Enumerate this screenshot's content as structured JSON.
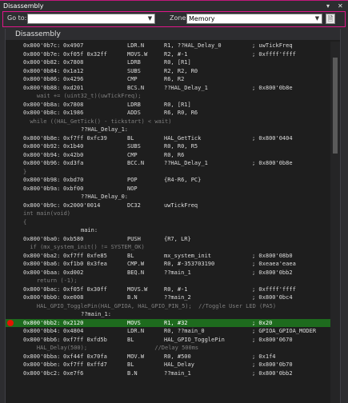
{
  "window": {
    "title": "Disassembly",
    "controls": [
      "▾",
      "✕"
    ]
  },
  "toolbar": {
    "goto_label": "Go to:",
    "goto_value": "",
    "zone_label": "Zone:",
    "zone_value": "Memory"
  },
  "panel": {
    "header": "Disassembly"
  },
  "rows": [
    {
      "kind": "asm",
      "addr": "0x800'0b7c:",
      "bytes": "0x4907",
      "mn": "LDR.N",
      "ops": "R1, ??HAL_Delay_0",
      "cmt": "; uwTickFreq"
    },
    {
      "kind": "asm",
      "addr": "0x800'0b7e:",
      "bytes": "0xf05f 0x32ff",
      "mn": "MOVS.W",
      "ops": "R2, #-1",
      "cmt": "; 0xffff'ffff"
    },
    {
      "kind": "asm",
      "addr": "0x800'0b82:",
      "bytes": "0x7808",
      "mn": "LDRB",
      "ops": "R0, [R1]",
      "cmt": ""
    },
    {
      "kind": "asm",
      "addr": "0x800'0b84:",
      "bytes": "0x1a12",
      "mn": "SUBS",
      "ops": "R2, R2, R0",
      "cmt": ""
    },
    {
      "kind": "asm",
      "addr": "0x800'0b86:",
      "bytes": "0x4296",
      "mn": "CMP",
      "ops": "R6, R2",
      "cmt": ""
    },
    {
      "kind": "asm",
      "addr": "0x800'0b88:",
      "bytes": "0xd201",
      "mn": "BCS.N",
      "ops": "??HAL_Delay_1",
      "cmt": "; 0x800'0b8e"
    },
    {
      "kind": "src",
      "text": "    wait += (uint32_t)(uwTickFreq);"
    },
    {
      "kind": "asm",
      "addr": "0x800'0b8a:",
      "bytes": "0x7808",
      "mn": "LDRB",
      "ops": "R0, [R1]",
      "cmt": ""
    },
    {
      "kind": "asm",
      "addr": "0x800'0b8c:",
      "bytes": "0x1986",
      "mn": "ADDS",
      "ops": "R6, R0, R6",
      "cmt": ""
    },
    {
      "kind": "src",
      "text": "  while ((HAL_GetTick() - tickstart) < wait)"
    },
    {
      "kind": "label",
      "text": "??HAL_Delay_1:"
    },
    {
      "kind": "asm",
      "addr": "0x800'0b8e:",
      "bytes": "0xf7ff 0xfc39",
      "mn": "BL",
      "ops": "HAL_GetTick",
      "cmt": "; 0x800'0404"
    },
    {
      "kind": "asm",
      "addr": "0x800'0b92:",
      "bytes": "0x1b40",
      "mn": "SUBS",
      "ops": "R0, R0, R5",
      "cmt": ""
    },
    {
      "kind": "asm",
      "addr": "0x800'0b94:",
      "bytes": "0x42b0",
      "mn": "CMP",
      "ops": "R0, R6",
      "cmt": ""
    },
    {
      "kind": "asm",
      "addr": "0x800'0b96:",
      "bytes": "0xd3fa",
      "mn": "BCC.N",
      "ops": "??HAL_Delay_1",
      "cmt": "; 0x800'0b8e"
    },
    {
      "kind": "src",
      "text": "}"
    },
    {
      "kind": "asm",
      "addr": "0x800'0b98:",
      "bytes": "0xbd70",
      "mn": "POP",
      "ops": "{R4-R6, PC}",
      "cmt": ""
    },
    {
      "kind": "asm",
      "addr": "0x800'0b9a:",
      "bytes": "0xbf00",
      "mn": "NOP",
      "ops": "",
      "cmt": ""
    },
    {
      "kind": "label",
      "text": "??HAL_Delay_0:"
    },
    {
      "kind": "asm",
      "addr": "0x800'0b9c:",
      "bytes": "0x2000'0014",
      "mn": "DC32",
      "ops": "uwTickFreq",
      "cmt": ""
    },
    {
      "kind": "src",
      "text": "int main(void)"
    },
    {
      "kind": "src",
      "text": "{"
    },
    {
      "kind": "label",
      "text": "main:"
    },
    {
      "kind": "asm",
      "addr": "0x800'0ba0:",
      "bytes": "0xb580",
      "mn": "PUSH",
      "ops": "{R7, LR}",
      "cmt": ""
    },
    {
      "kind": "src",
      "text": "  if (mx_system_init() != SYSTEM_OK)"
    },
    {
      "kind": "asm",
      "addr": "0x800'0ba2:",
      "bytes": "0xf7ff 0xfe85",
      "mn": "BL",
      "ops": "mx_system_init",
      "cmt": "; 0x800'08b0"
    },
    {
      "kind": "asm",
      "addr": "0x800'0ba6:",
      "bytes": "0xf1b0 0x3fea",
      "mn": "CMP.W",
      "ops": "R0, #-353703190",
      "cmt": "; 0xeaea'eaea"
    },
    {
      "kind": "asm",
      "addr": "0x800'0baa:",
      "bytes": "0xd002",
      "mn": "BEQ.N",
      "ops": "??main_1",
      "cmt": "; 0x800'0bb2"
    },
    {
      "kind": "src",
      "text": "    return (-1);"
    },
    {
      "kind": "asm",
      "addr": "0x800'0bac:",
      "bytes": "0xf05f 0x30ff",
      "mn": "MOVS.W",
      "ops": "R0, #-1",
      "cmt": "; 0xffff'ffff"
    },
    {
      "kind": "asm",
      "addr": "0x800'0bb0:",
      "bytes": "0xe008",
      "mn": "B.N",
      "ops": "??main_2",
      "cmt": "; 0x800'0bc4"
    },
    {
      "kind": "src",
      "text": "    HAL_GPIO_TogglePin(HAL_GPIOA, HAL_GPIO_PIN_5);  //Toggle User LED (PA5)"
    },
    {
      "kind": "label",
      "text": "??main_1:"
    },
    {
      "kind": "bp",
      "addr": "0x800'0bb2:",
      "bytes": "0x2120",
      "mn": "MOVS",
      "ops": "R1, #32",
      "cmt": "; 0x20"
    },
    {
      "kind": "asm",
      "addr": "0x800'0bb4:",
      "bytes": "0x4804",
      "mn": "LDR.N",
      "ops": "R0, ??main_0",
      "cmt": "; GPIOA_GPIOA_MODER"
    },
    {
      "kind": "asm",
      "addr": "0x800'0bb6:",
      "bytes": "0xf7ff 0xfd5b",
      "mn": "BL",
      "ops": "HAL_GPIO_TogglePin",
      "cmt": "; 0x800'0670"
    },
    {
      "kind": "src",
      "text": "    HAL_Delay(500);                    //Delay 500ms"
    },
    {
      "kind": "asm",
      "addr": "0x800'0bba:",
      "bytes": "0xf44f 0x70fa",
      "mn": "MOV.W",
      "ops": "R0, #500",
      "cmt": "; 0x1f4"
    },
    {
      "kind": "asm",
      "addr": "0x800'0bbe:",
      "bytes": "0xf7ff 0xffd7",
      "mn": "BL",
      "ops": "HAL_Delay",
      "cmt": "; 0x800'0b70"
    },
    {
      "kind": "asm",
      "addr": "0x800'0bc2:",
      "bytes": "0xe7f6",
      "mn": "B.N",
      "ops": "??main_1",
      "cmt": "; 0x800'0bb2"
    }
  ],
  "colors": {
    "accent": "#e0168a",
    "breakpoint_line": "#1e6b1e",
    "breakpoint_dot": "#e51400",
    "source_text": "#7f7f7f"
  }
}
